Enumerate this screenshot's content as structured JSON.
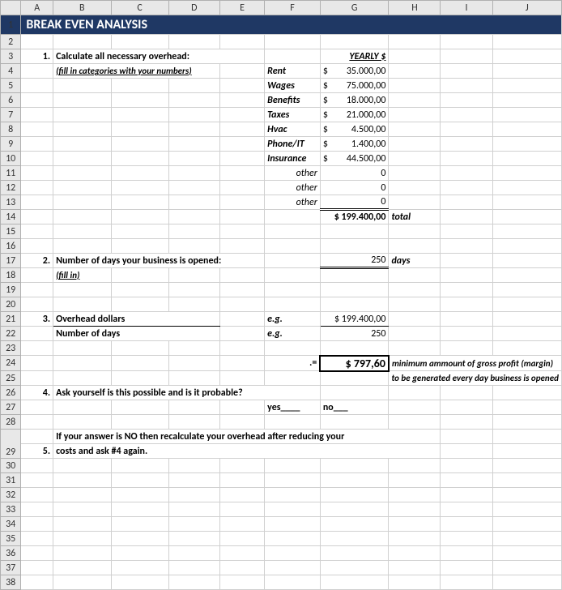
{
  "columns": [
    "A",
    "B",
    "C",
    "D",
    "E",
    "F",
    "G",
    "H",
    "I",
    "J"
  ],
  "title": "BREAK EVEN ANALYSIS",
  "rows": {
    "3": {
      "num": "1.",
      "text": "Calculate all necessary overhead:",
      "g": "YEARLY  $"
    },
    "4": {
      "text": "(fill in categories with your numbers)",
      "f": "Rent",
      "g_cur": "$",
      "g": "35.000,00"
    },
    "5": {
      "f": "Wages",
      "g_cur": "$",
      "g": "75.000,00"
    },
    "6": {
      "f": "Benefits",
      "g_cur": "$",
      "g": "18.000,00"
    },
    "7": {
      "f": "Taxes",
      "g_cur": "$",
      "g": "21.000,00"
    },
    "8": {
      "f": "Hvac",
      "g_cur": "$",
      "g": "4.500,00"
    },
    "9": {
      "f": "Phone/IT",
      "g_cur": "$",
      "g": "1.400,00"
    },
    "10": {
      "f": "Insurance",
      "g_cur": "$",
      "g": "44.500,00"
    },
    "11": {
      "f": "other",
      "g": "0"
    },
    "12": {
      "f": "other",
      "g": "0"
    },
    "13": {
      "f": "other",
      "g": "0"
    },
    "14": {
      "g": "$ 199.400,00",
      "h": "total"
    },
    "17": {
      "num": "2.",
      "text": "Number of days your business is opened:",
      "g": "250",
      "h": "days"
    },
    "18": {
      "text": "(fill in)"
    },
    "21": {
      "num": "3.",
      "text": "Overhead dollars",
      "f": "e.g.",
      "g": "$ 199.400,00"
    },
    "22": {
      "text": "Number of days",
      "f": "e.g.",
      "g": "250"
    },
    "24": {
      "f": ".=",
      "g": "$    797,60",
      "h": "minimum ammount of gross profit (margin)"
    },
    "25": {
      "h": "to be generated every day business is opened"
    },
    "26": {
      "num": "4.",
      "text": "Ask yourself is this possible and is it probable?"
    },
    "27": {
      "f": "yes____",
      "g": "no___"
    },
    "29a": "If your answer is NO then recalculate your overhead after reducing your",
    "29": {
      "num": "5.",
      "text": "costs and ask #4 again."
    }
  }
}
